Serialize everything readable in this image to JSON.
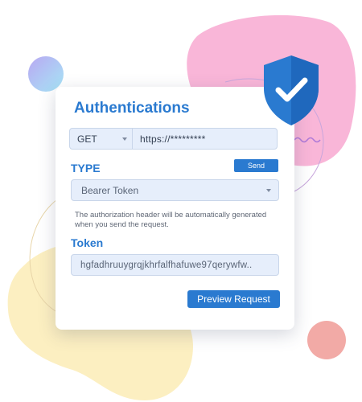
{
  "card": {
    "title": "Authentications",
    "request": {
      "method": "GET",
      "url": "https://*********"
    },
    "type_label": "TYPE",
    "send_label": "Send",
    "auth_type": "Bearer Token",
    "help_text": "The authorization header will be automatically generated when you send the request.",
    "token_label": "Token",
    "token_value": "hgfadhruuygrqjkhrfalfhafuwe97qerywfw..",
    "preview_label": "Preview Request"
  },
  "colors": {
    "accent": "#2a7ad0",
    "field_background": "#e6eefb",
    "shield": "#2a7ad0",
    "blob_pink": "#f9b6d8",
    "blob_yellow": "#fcefc1",
    "circle_salmon": "#f2aaa6"
  },
  "icons": {
    "shield": "shield-check-icon",
    "dropdown": "chevron-down-icon"
  }
}
